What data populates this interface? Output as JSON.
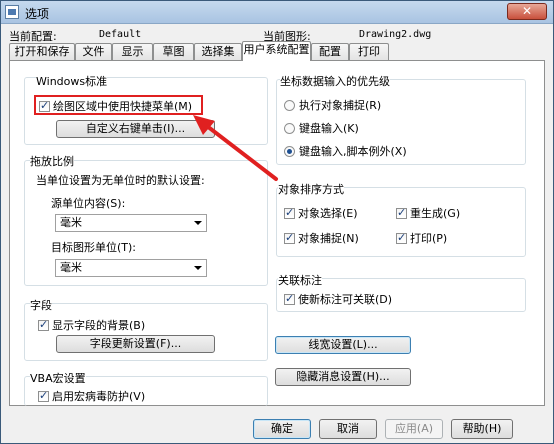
{
  "window": {
    "title": "选项",
    "close": "✕"
  },
  "profile": {
    "current_config_label": "当前配置:",
    "current_config_value": "Default",
    "current_drawing_label": "当前图形:",
    "current_drawing_value": "Drawing2.dwg"
  },
  "tabs": [
    {
      "label": "打开和保存"
    },
    {
      "label": "文件"
    },
    {
      "label": "显示"
    },
    {
      "label": "草图"
    },
    {
      "label": "选择集"
    },
    {
      "label": "用户系统配置"
    },
    {
      "label": "配置"
    },
    {
      "label": "打印"
    }
  ],
  "windows_std": {
    "title": "Windows标准",
    "shortcut_menu_label": "绘图区域中使用快捷菜单(M)",
    "shortcut_menu_checked": true,
    "custom_right_click": "自定义右键单击(I)..."
  },
  "scale": {
    "title": "拖放比例",
    "desc": "当单位设置为无单位时的默认设置:",
    "source_label": "源单位内容(S):",
    "source_value": "毫米",
    "target_label": "目标图形单位(T):",
    "target_value": "毫米"
  },
  "field": {
    "title": "字段",
    "show_bg_label": "显示字段的背景(B)",
    "show_bg_checked": true,
    "update_settings": "字段更新设置(F)..."
  },
  "vba": {
    "title": "VBA宏设置",
    "antivirus_label": "启用宏病毒防护(V)",
    "antivirus_checked": true
  },
  "coord": {
    "title": "坐标数据输入的优先级",
    "options": [
      {
        "label": "执行对象捕捉(R)",
        "selected": false
      },
      {
        "label": "键盘输入(K)",
        "selected": false
      },
      {
        "label": "键盘输入,脚本例外(X)",
        "selected": true
      }
    ]
  },
  "sort": {
    "title": "对象排序方式",
    "options": [
      {
        "label": "对象选择(E)",
        "checked": true
      },
      {
        "label": "重生成(G)",
        "checked": true
      },
      {
        "label": "对象捕捉(N)",
        "checked": true
      },
      {
        "label": "打印(P)",
        "checked": true
      }
    ]
  },
  "assoc": {
    "title": "关联标注",
    "new_assoc_label": "使新标注可关联(D)",
    "new_assoc_checked": true
  },
  "buttons": {
    "lineweight": "线宽设置(L)...",
    "hidden_msg": "隐藏消息设置(H)...",
    "ok": "确定",
    "cancel": "取消",
    "apply": "应用(A)",
    "help": "帮助(H)"
  },
  "colors": {
    "highlight": "#e02020",
    "accent": "#3c7fb1"
  }
}
